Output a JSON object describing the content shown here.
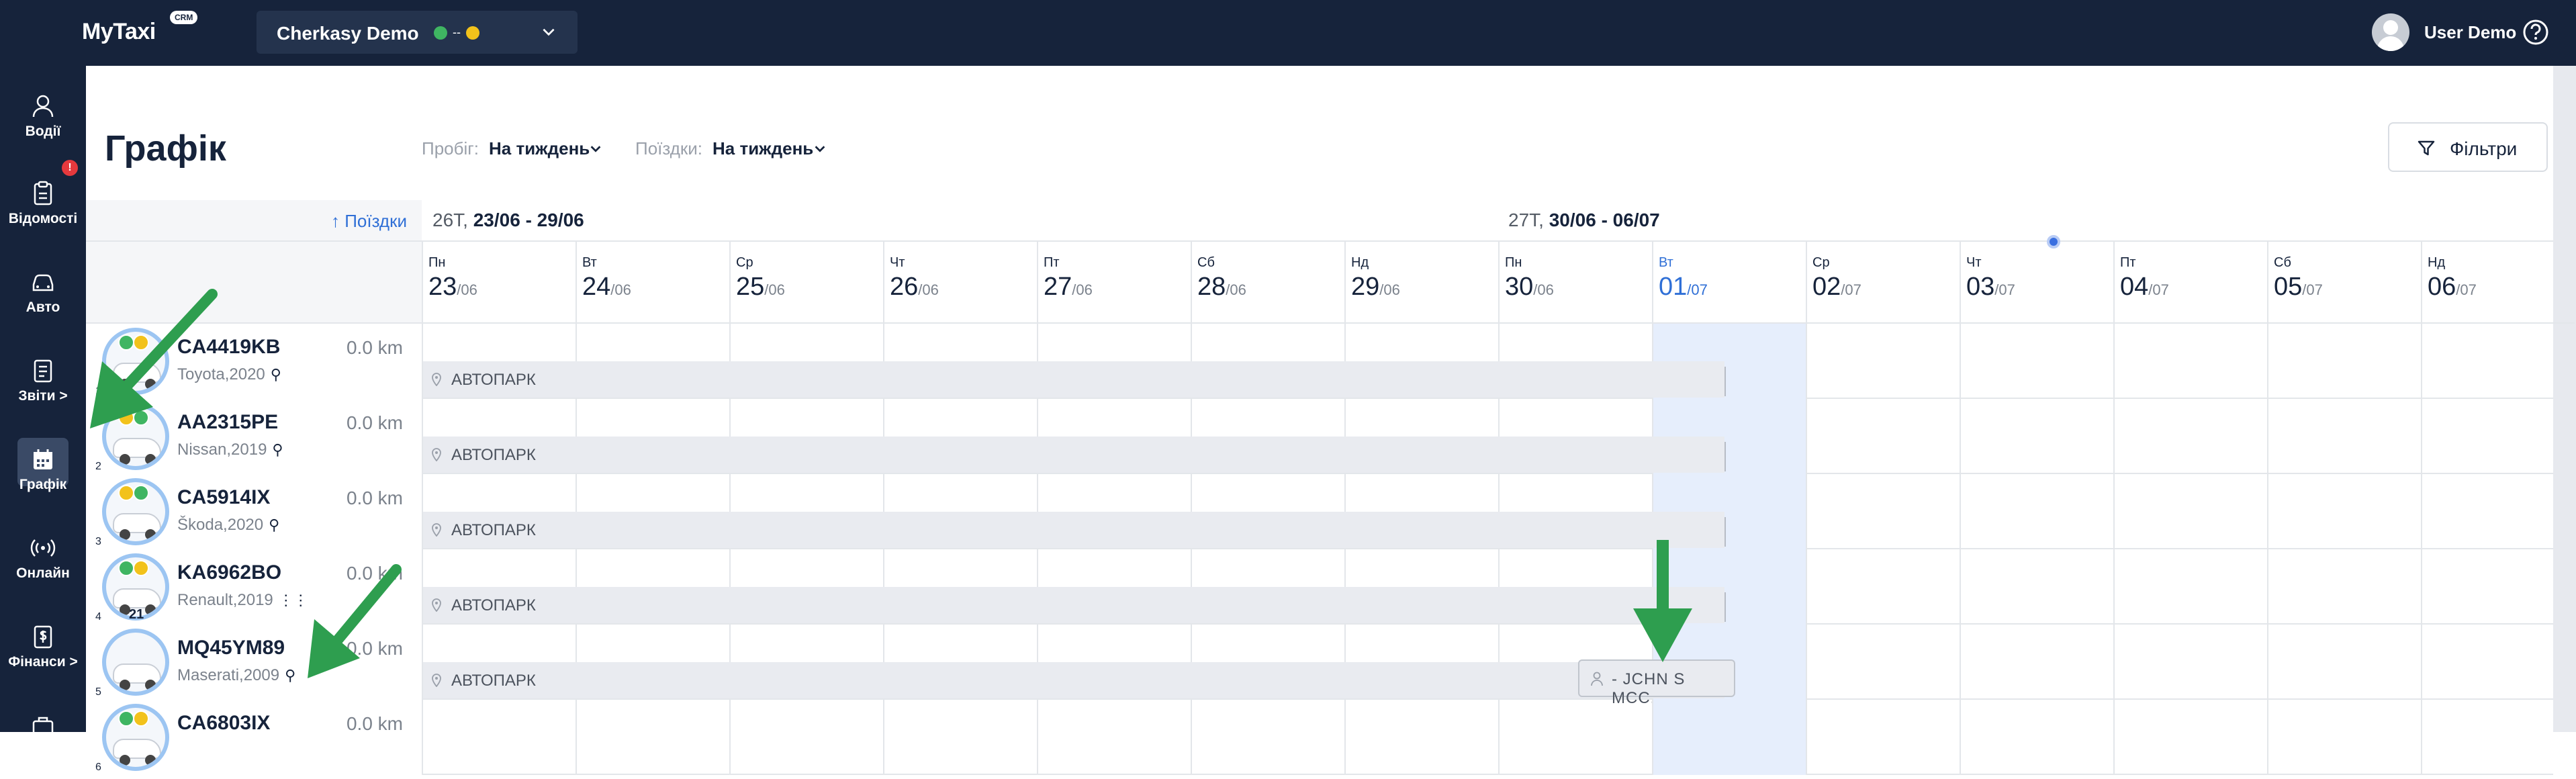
{
  "header": {
    "logo": "MyTaxi",
    "logo_badge": "CRM",
    "company": "Cherkasy Demo",
    "company_status_separator": "--",
    "user_name": "User Demo"
  },
  "sidebar": {
    "items": [
      {
        "label": "Водії",
        "icon": "driver-icon"
      },
      {
        "label": "Відомості",
        "icon": "clipboard-icon",
        "badge": "!"
      },
      {
        "label": "Авто",
        "icon": "car-icon"
      },
      {
        "label": "Звіти >",
        "icon": "report-icon"
      },
      {
        "label": "Графік",
        "icon": "calendar-icon",
        "active": true
      },
      {
        "label": "Онлайн",
        "icon": "broadcast-icon"
      },
      {
        "label": "Фінанси >",
        "icon": "finance-icon"
      }
    ]
  },
  "page": {
    "title": "Графік",
    "mileage_label": "Пробіг:",
    "mileage_value": "На тиждень",
    "trips_label": "Поїздки:",
    "trips_value": "На тиждень",
    "filters_button": "Фільтри",
    "trips_sort_link": "↑ Поїздки"
  },
  "weeks": [
    {
      "num": "26Т,",
      "range": "23/06 - 29/06"
    },
    {
      "num": "27Т,",
      "range": "30/06 - 06/07"
    }
  ],
  "days": [
    {
      "name": "Пн",
      "num": "23",
      "month": "/06"
    },
    {
      "name": "Вт",
      "num": "24",
      "month": "/06"
    },
    {
      "name": "Ср",
      "num": "25",
      "month": "/06"
    },
    {
      "name": "Чт",
      "num": "26",
      "month": "/06"
    },
    {
      "name": "Пт",
      "num": "27",
      "month": "/06"
    },
    {
      "name": "Сб",
      "num": "28",
      "month": "/06"
    },
    {
      "name": "Нд",
      "num": "29",
      "month": "/06"
    },
    {
      "name": "Пн",
      "num": "30",
      "month": "/06"
    },
    {
      "name": "Вт",
      "num": "01",
      "month": "/07",
      "today": true
    },
    {
      "name": "Ср",
      "num": "02",
      "month": "/07"
    },
    {
      "name": "Чт",
      "num": "03",
      "month": "/07"
    },
    {
      "name": "Пт",
      "num": "04",
      "month": "/07"
    },
    {
      "name": "Сб",
      "num": "05",
      "month": "/07"
    },
    {
      "name": "Нд",
      "num": "06",
      "month": "/07"
    }
  ],
  "vehicles": [
    {
      "index": "1",
      "plate": "CA4419KB",
      "km": "0.0 km",
      "model": "Toyota,2020",
      "gear": "automatic",
      "location": "АВТОПАРК"
    },
    {
      "index": "2",
      "plate": "AA2315PE",
      "km": "0.0 km",
      "model": "Nissan,2019",
      "gear": "automatic",
      "location": "АВТОПАРК"
    },
    {
      "index": "3",
      "plate": "CA5914IX",
      "km": "0.0 km",
      "model": "Škoda,2020",
      "gear": "automatic",
      "location": "АВТОПАРК"
    },
    {
      "index": "4",
      "plate": "KA6962BO",
      "km": "0.0 km",
      "model": "Renault,2019",
      "gear": "manual",
      "location": "АВТОПАРК",
      "badge_number": "21"
    },
    {
      "index": "5",
      "plate": "MQ45YM89",
      "km": "0.0 km",
      "model": "Maserati,2009",
      "gear": "automatic",
      "location": "АВТОПАРК",
      "driver_chip": "- JCHN S MCC."
    },
    {
      "index": "6",
      "plate": "CA6803IX",
      "km": "0.0 km"
    }
  ],
  "colors": {
    "nav_bg": "#16233b",
    "accent_blue": "#2f6fd6",
    "today_bg": "#e6eefc",
    "arrow_green": "#2e9e4f"
  }
}
